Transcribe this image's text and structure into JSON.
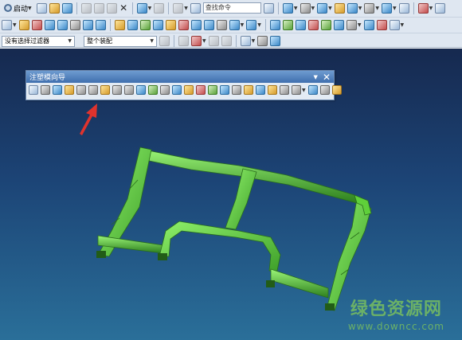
{
  "toolbar": {
    "start_label": "启动",
    "command_search": "查找命令",
    "filter_select": "没有选择过滤器",
    "assembly_select": "整个装配"
  },
  "panel": {
    "title": "注塑模向导",
    "pin_icon": "down-triangle",
    "close_icon": "close-x"
  },
  "watermark": {
    "site_name": "绿色资源网",
    "url": "www.downcc.com"
  },
  "colors": {
    "toolbar_bg": "#dfe7f1",
    "viewport_top": "#16294f",
    "viewport_bottom": "#2a6f99",
    "model_green": "#5fd03a",
    "arrow_red": "#e0332d",
    "panel_title": "#3f6fae"
  }
}
